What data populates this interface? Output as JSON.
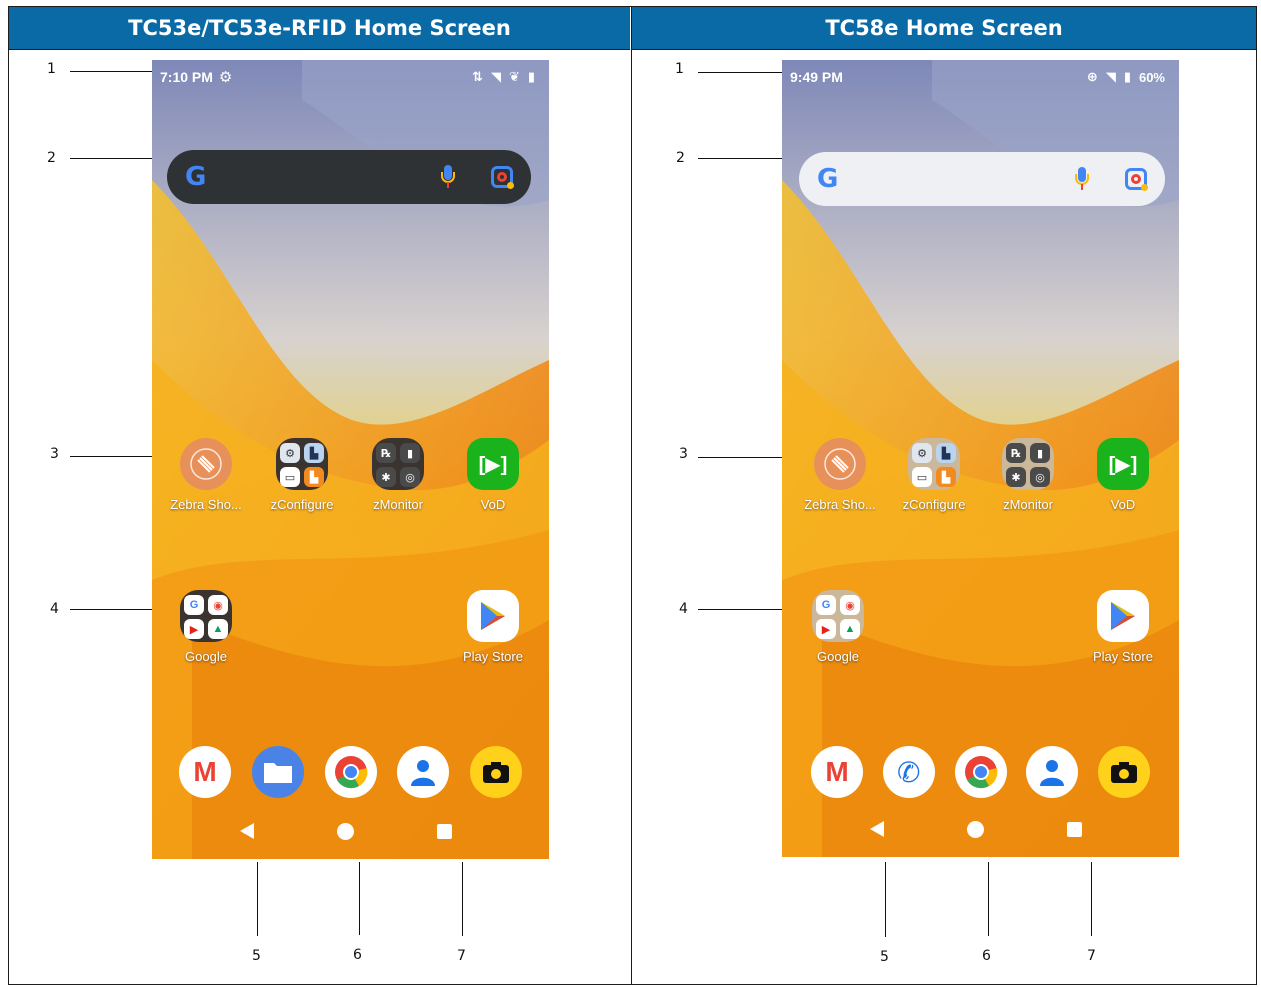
{
  "headers": {
    "left": "TC53e/TC53e-RFID Home Screen",
    "right": "TC58e Home Screen"
  },
  "callouts": [
    "1",
    "2",
    "3",
    "4",
    "5",
    "6",
    "7"
  ],
  "left_screen": {
    "status": {
      "time": "7:10 PM"
    },
    "search": {
      "logo": "G"
    },
    "apps_row1": [
      {
        "label": "Zebra Sho...",
        "icon": "zebra-showcase-icon"
      },
      {
        "label": "zConfigure",
        "icon": "zconfigure-folder-icon"
      },
      {
        "label": "zMonitor",
        "icon": "zmonitor-folder-icon"
      },
      {
        "label": "VoD",
        "icon": "vod-icon"
      }
    ],
    "apps_row2": [
      {
        "label": "Google",
        "icon": "google-folder-icon"
      },
      {
        "label": "Play Store",
        "icon": "play-store-icon"
      }
    ],
    "dock": [
      "gmail-icon",
      "files-icon",
      "chrome-icon",
      "contacts-icon",
      "camera-icon"
    ]
  },
  "right_screen": {
    "status": {
      "time": "9:49 PM",
      "battery": "60%"
    },
    "search": {
      "logo": "G"
    },
    "apps_row1": [
      {
        "label": "Zebra Sho...",
        "icon": "zebra-showcase-icon"
      },
      {
        "label": "zConfigure",
        "icon": "zconfigure-folder-icon"
      },
      {
        "label": "zMonitor",
        "icon": "zmonitor-folder-icon"
      },
      {
        "label": "VoD",
        "icon": "vod-icon"
      }
    ],
    "apps_row2": [
      {
        "label": "Google",
        "icon": "google-folder-icon"
      },
      {
        "label": "Play Store",
        "icon": "play-store-icon"
      }
    ],
    "dock": [
      "gmail-icon",
      "phone-icon",
      "chrome-icon",
      "contacts-icon",
      "camera-icon"
    ]
  },
  "colors": {
    "header_bg": "#0a6aa6",
    "wallpaper_orange": "#f0a020",
    "wallpaper_sky": "#8fa6c9"
  }
}
